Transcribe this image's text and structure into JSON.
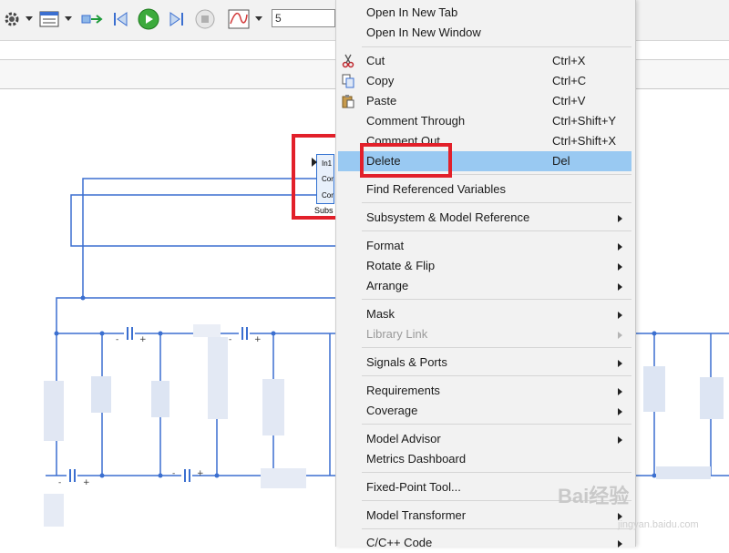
{
  "toolbar": {
    "stop_time_value": "5",
    "icons": [
      "settings-gear-icon",
      "model-explorer-icon",
      "update-diagram-icon",
      "step-back-icon",
      "run-icon",
      "step-forward-icon",
      "stop-icon",
      "scope-icon"
    ]
  },
  "subsystem": {
    "ports": [
      "In1",
      "Cor",
      "Cor"
    ],
    "name": "Subs"
  },
  "menu": {
    "items": [
      {
        "label": "Open In New Tab",
        "shortcut": ""
      },
      {
        "label": "Open In New Window",
        "shortcut": ""
      },
      {
        "label": "Cut",
        "shortcut": "Ctrl+X"
      },
      {
        "label": "Copy",
        "shortcut": "Ctrl+C"
      },
      {
        "label": "Paste",
        "shortcut": "Ctrl+V"
      },
      {
        "label": "Comment Through",
        "shortcut": "Ctrl+Shift+Y"
      },
      {
        "label": "Comment Out",
        "shortcut": "Ctrl+Shift+X"
      },
      {
        "label": "Delete",
        "shortcut": "Del"
      },
      {
        "label": "Find Referenced Variables",
        "shortcut": ""
      },
      {
        "label": "Subsystem & Model Reference",
        "shortcut": ""
      },
      {
        "label": "Format",
        "shortcut": ""
      },
      {
        "label": "Rotate & Flip",
        "shortcut": ""
      },
      {
        "label": "Arrange",
        "shortcut": ""
      },
      {
        "label": "Mask",
        "shortcut": ""
      },
      {
        "label": "Library Link",
        "shortcut": ""
      },
      {
        "label": "Signals & Ports",
        "shortcut": ""
      },
      {
        "label": "Requirements",
        "shortcut": ""
      },
      {
        "label": "Coverage",
        "shortcut": ""
      },
      {
        "label": "Model Advisor",
        "shortcut": ""
      },
      {
        "label": "Metrics Dashboard",
        "shortcut": ""
      },
      {
        "label": "Fixed-Point Tool...",
        "shortcut": ""
      },
      {
        "label": "Model Transformer",
        "shortcut": ""
      },
      {
        "label": "C/C++ Code",
        "shortcut": ""
      }
    ]
  },
  "watermark": {
    "text": "Bai经验",
    "url": "jingyan.baidu.com"
  },
  "colors": {
    "highlight": "#99c9f2",
    "annotation_red": "#e2202a",
    "wire_blue": "#3b6fd0"
  }
}
